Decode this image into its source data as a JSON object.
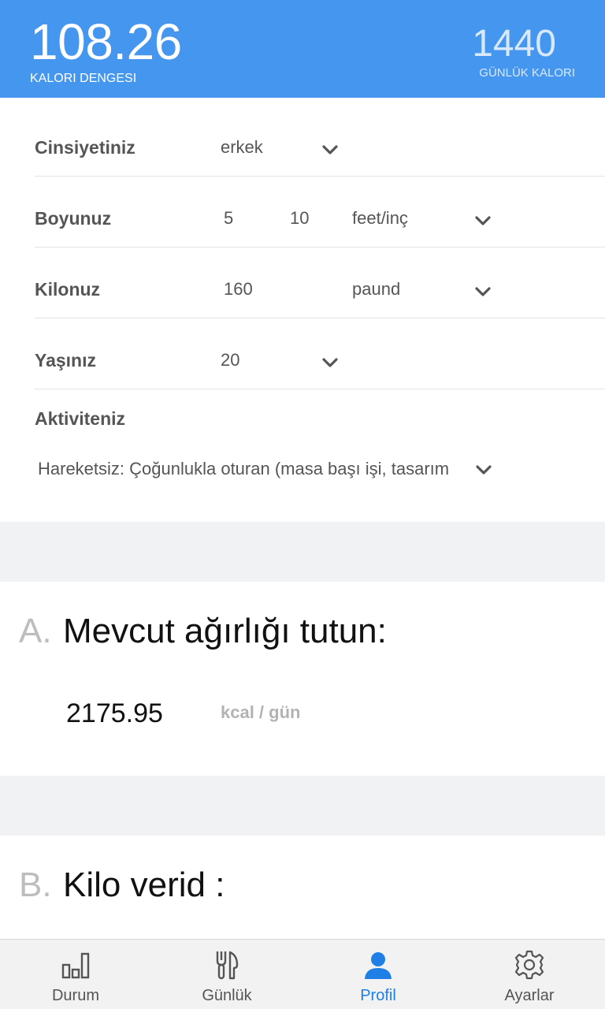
{
  "header": {
    "balance_value": "108.26",
    "balance_label": "KALORI DENGESI",
    "daily_value": "1440",
    "daily_label": "GÜNLÜK KALORI",
    "bg_color": "#4596ef"
  },
  "form": {
    "gender": {
      "label": "Cinsiyetiniz",
      "value": "erkek"
    },
    "height": {
      "label": "Boyunuz",
      "feet": "5",
      "inch": "10",
      "unit": "feet/inç"
    },
    "weight": {
      "label": "Kilonuz",
      "value": "160",
      "unit": "paund"
    },
    "age": {
      "label": "Yaşınız",
      "value": "20"
    },
    "activity": {
      "label": "Aktiviteniz",
      "value": "Hareketsiz: Çoğunlukla oturan (masa başı işi, tasarım"
    }
  },
  "maintain": {
    "letter": "A.",
    "title": "Mevcut ağırlığı tutun:",
    "value": "2175.95",
    "unit": "kcal / gün"
  },
  "lose": {
    "letter": "B.",
    "title": "Kilo verid :"
  },
  "tabs": [
    {
      "label": "Durum",
      "icon": "bar-chart-icon",
      "active": false
    },
    {
      "label": "Günlük",
      "icon": "fork-knife-icon",
      "active": false
    },
    {
      "label": "Profil",
      "icon": "person-icon",
      "active": true
    },
    {
      "label": "Ayarlar",
      "icon": "gear-icon",
      "active": false
    }
  ],
  "colors": {
    "accent": "#1f7fe6",
    "divider": "#e3e3e3",
    "section_gap": "#f1f2f4"
  }
}
